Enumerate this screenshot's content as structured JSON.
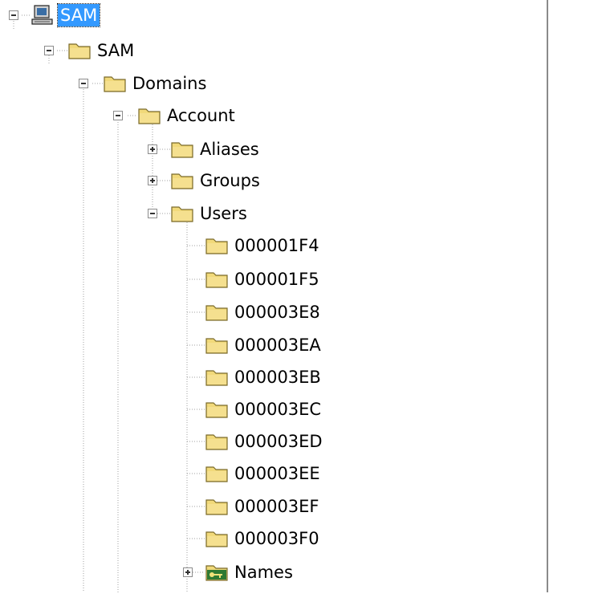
{
  "tree": {
    "root": {
      "label": "SAM",
      "icon": "computer-icon",
      "selected": true
    },
    "nodes": {
      "sam": "SAM",
      "domains": "Domains",
      "account": "Account",
      "aliases": "Aliases",
      "groups": "Groups",
      "users": "Users",
      "names": "Names"
    },
    "user_keys": [
      "000001F4",
      "000001F5",
      "000003E8",
      "000003EA",
      "000003EB",
      "000003EC",
      "000003ED",
      "000003EE",
      "000003EF",
      "000003F0"
    ]
  },
  "colors": {
    "selection": "#3399ff",
    "folder": "#f1d97a",
    "tree_lines": "#a0a0a0"
  }
}
